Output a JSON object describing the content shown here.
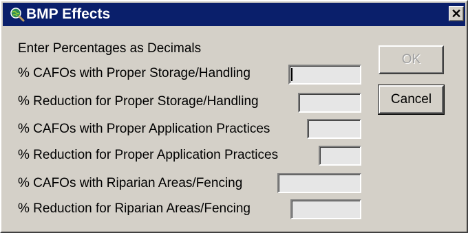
{
  "window": {
    "title": "BMP Effects",
    "icon": "globe-magnifier-icon",
    "close_label": "✕"
  },
  "instructions": "Enter Percentages as Decimals",
  "fields": [
    {
      "label": "% CAFOs with Proper Storage/Handling",
      "value": "",
      "focused": true
    },
    {
      "label": "% Reduction for Proper Storage/Handling",
      "value": ""
    },
    {
      "label": "% CAFOs with Proper Application Practices",
      "value": ""
    },
    {
      "label": "% Reduction for Proper Application Practices",
      "value": ""
    },
    {
      "label": "% CAFOs with Riparian Areas/Fencing",
      "value": ""
    },
    {
      "label": "% Reduction for Riparian Areas/Fencing",
      "value": ""
    }
  ],
  "buttons": {
    "ok": {
      "label": "OK",
      "enabled": false
    },
    "cancel": {
      "label": "Cancel",
      "enabled": true
    }
  },
  "colors": {
    "titlebar": "#0a1f6b",
    "dialog_bg": "#d4d0c8",
    "field_bg": "#e6e6e6"
  }
}
